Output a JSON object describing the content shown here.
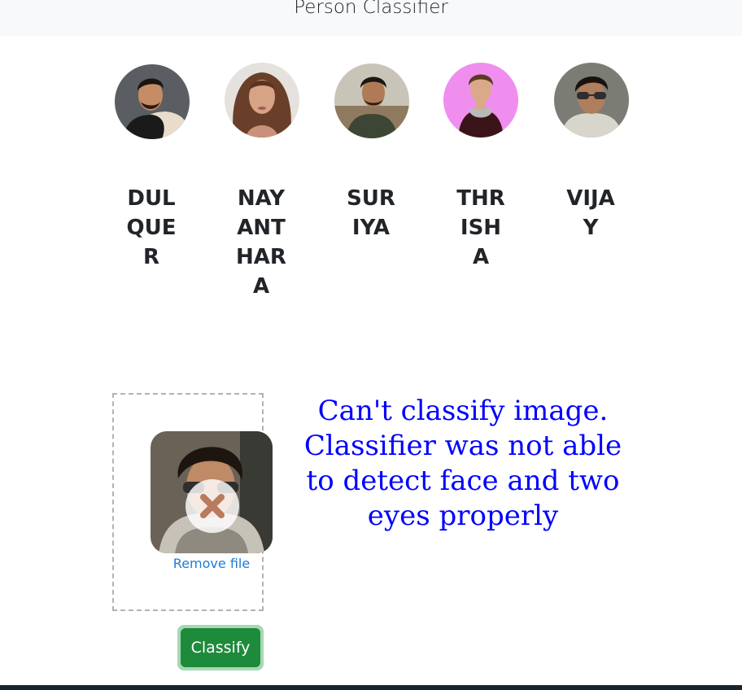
{
  "header": {
    "title": "Person Classifier"
  },
  "people": [
    {
      "name": "DULQUER"
    },
    {
      "name": "NAYANTHARA"
    },
    {
      "name": "SURIYA"
    },
    {
      "name": "THRISHA"
    },
    {
      "name": "VIJAY"
    }
  ],
  "upload": {
    "remove_label": "Remove file",
    "icon": "close-icon"
  },
  "result": {
    "message": "Can't classify image. Classifier was not able to detect face and two eyes properly"
  },
  "actions": {
    "classify_label": "Classify"
  },
  "colors": {
    "header_bg": "#f8f9fa",
    "message": "#0000ff",
    "link": "#1f7bd6",
    "button": "#1e8a3b",
    "footer": "#17252c"
  }
}
